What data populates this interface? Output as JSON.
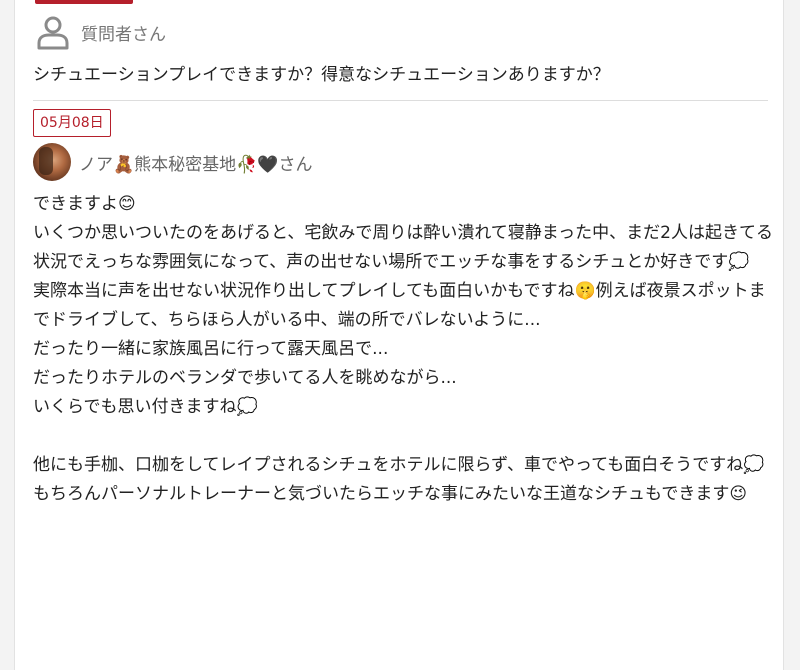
{
  "asker": {
    "name": "質問者さん",
    "icon": "user-icon"
  },
  "question": {
    "text": "シチュエーションプレイできますか？得意なシチュエーションありますか？"
  },
  "answer": {
    "date": "05月08日",
    "answerer_name": "ノア🧸熊本秘密基地🥀🖤さん",
    "lines": [
      "できますよ😊",
      "いくつか思いついたのをあげると、宅飲みで周りは酔い潰れて寝静まった中、まだ2人は起きてる状況でえっちな雰囲気になって、声の出せない場所でエッチな事をするシチュとか好きです💭",
      "実際本当に声を出せない状況作り出してプレイしても面白いかもですね🤫例えば夜景スポットまでドライブして、ちらほら人がいる中、端の所でバレないように...",
      "だったり一緒に家族風呂に行って露天風呂で...",
      "だったりホテルのベランダで歩いてる人を眺めながら...",
      "いくらでも思い付きますね💭",
      "",
      "他にも手枷、口枷をしてレイプされるシチュをホテルに限らず、車でやっても面白そうですね💭",
      "もちろんパーソナルトレーナーと気づいたらエッチな事にみたいな王道なシチュもできます😉"
    ]
  },
  "colors": {
    "accent": "#b51f2b",
    "text": "#222222",
    "muted": "#777777",
    "divider": "#dddddd"
  }
}
